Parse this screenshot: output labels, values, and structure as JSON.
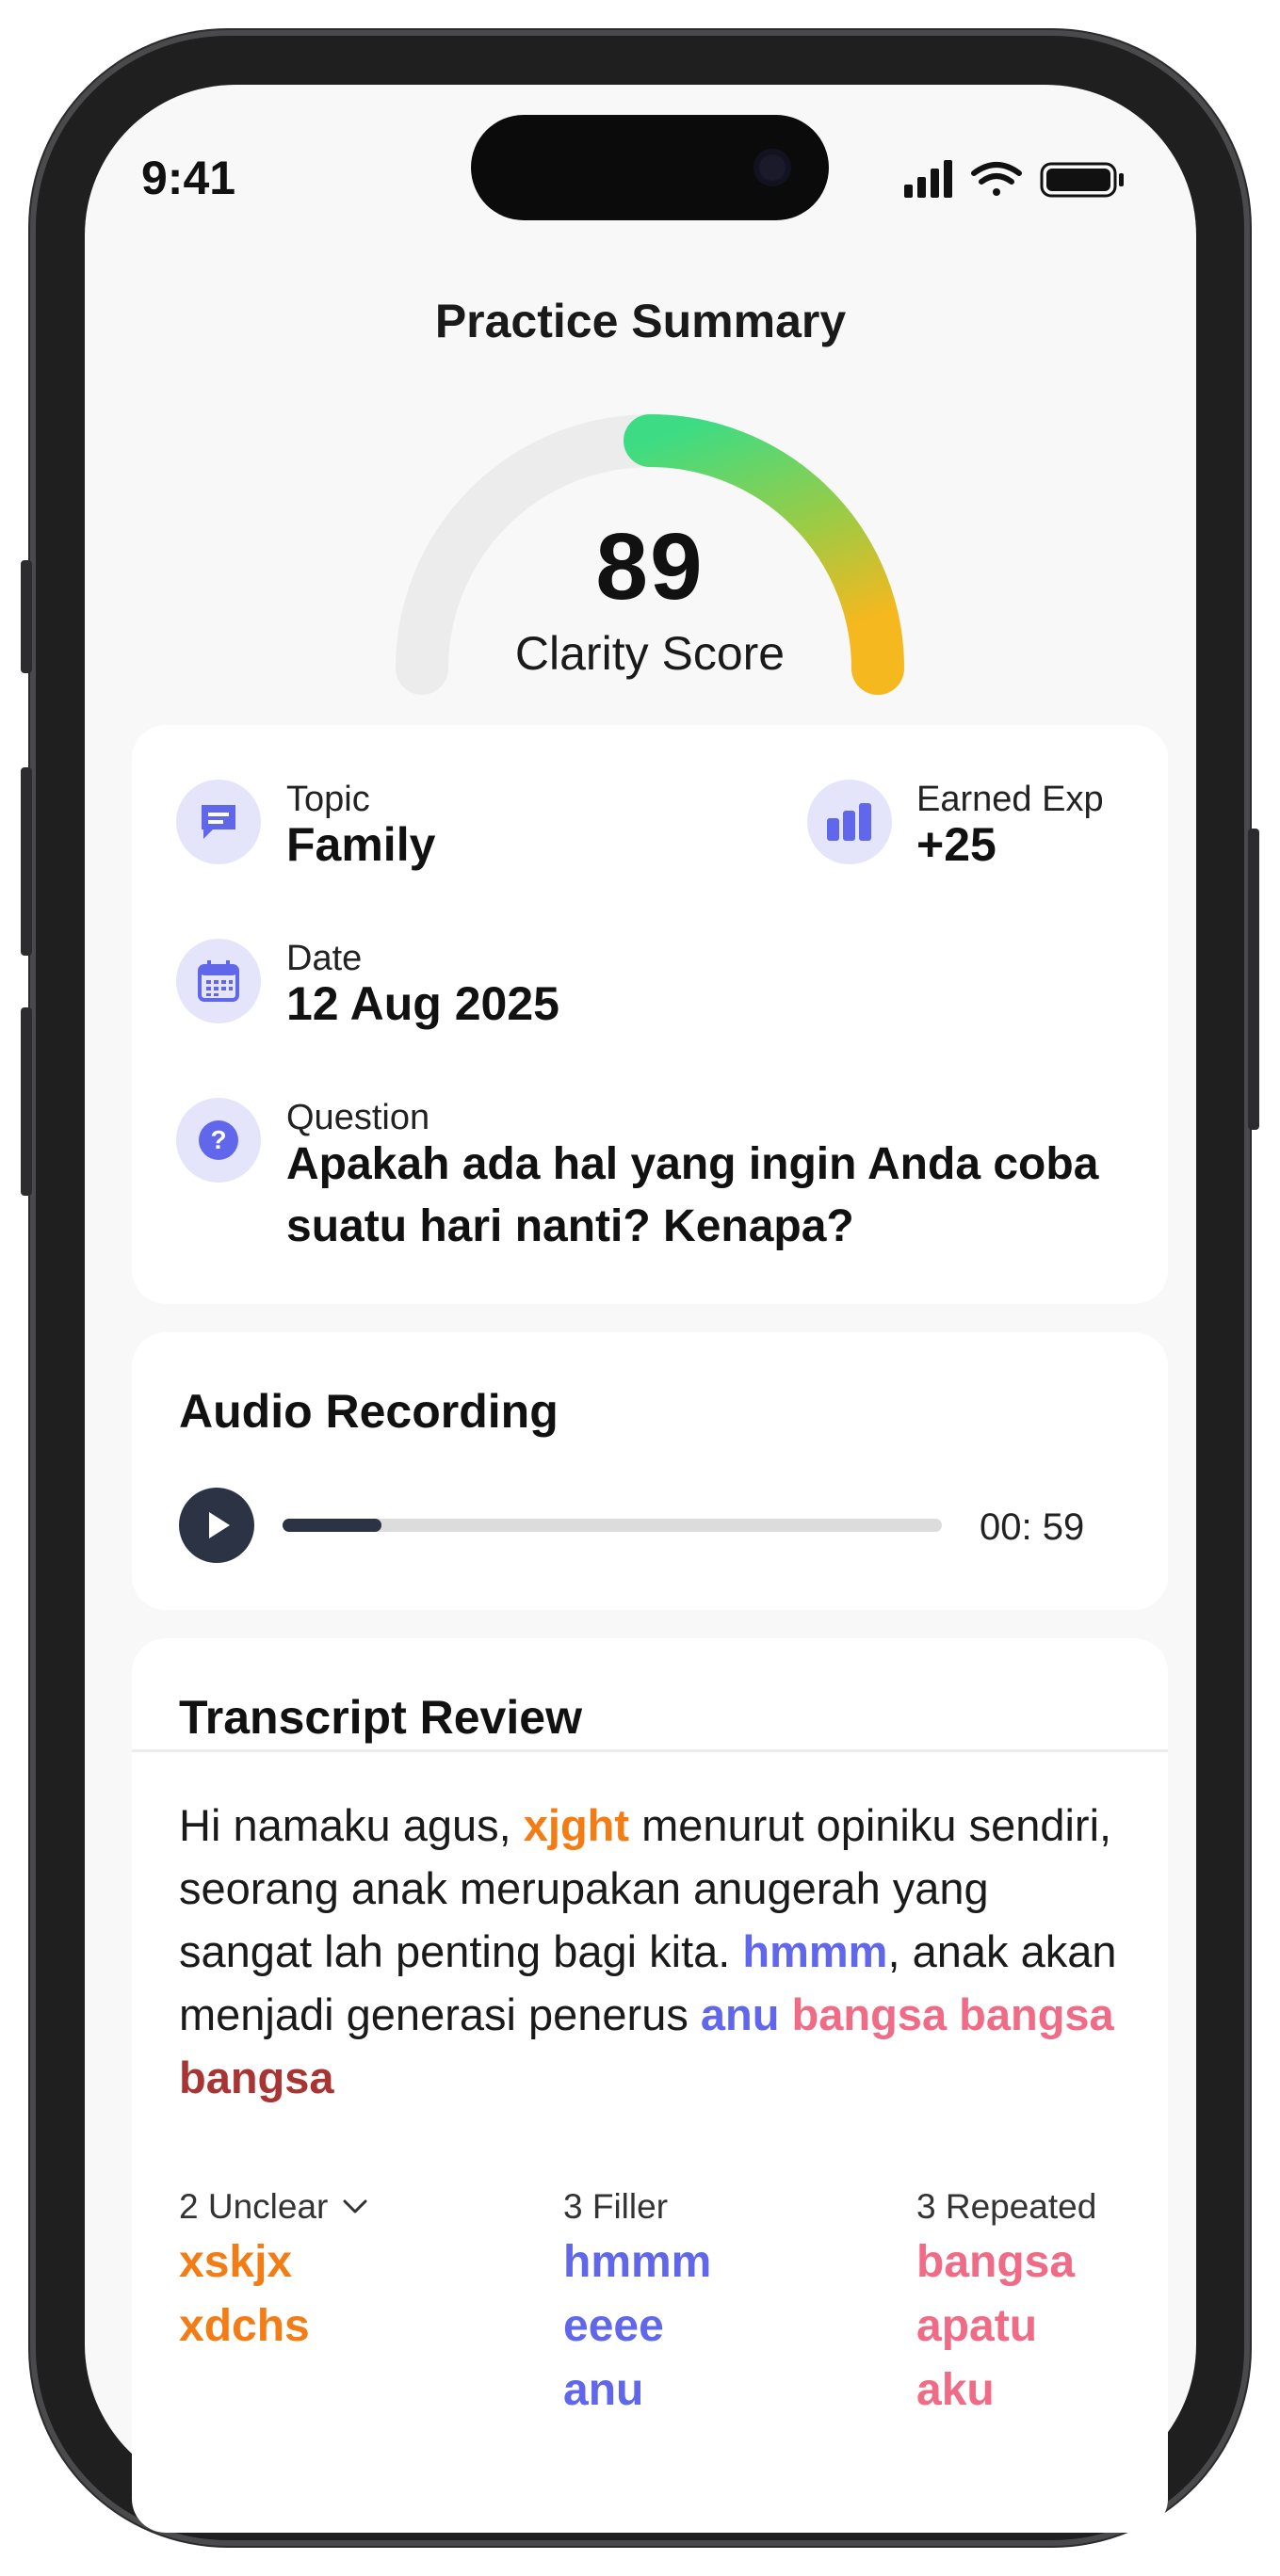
{
  "status": {
    "time": "9:41"
  },
  "header": {
    "title": "Practice Summary"
  },
  "score": {
    "value": "89",
    "label": "Clarity Score",
    "fraction": 0.89
  },
  "details": {
    "topic": {
      "label": "Topic",
      "value": "Family"
    },
    "exp": {
      "label": "Earned Exp",
      "value": "+25"
    },
    "date": {
      "label": "Date",
      "value": "12 Aug 2025"
    },
    "question": {
      "label": "Question",
      "value": "Apakah ada hal yang ingin Anda coba suatu hari nanti? Kenapa?"
    }
  },
  "audio": {
    "title": "Audio Recording",
    "duration": "00: 59",
    "progress": 0.15
  },
  "transcript": {
    "title": "Transcript Review",
    "segments": [
      {
        "text": "Hi namaku agus, ",
        "type": "plain"
      },
      {
        "text": "xjght",
        "type": "unclear"
      },
      {
        "text": " menurut opiniku sendiri, seorang anak merupakan anugerah yang sangat lah penting bagi kita. ",
        "type": "plain"
      },
      {
        "text": "hmmm",
        "type": "filler"
      },
      {
        "text": ", anak akan menjadi generasi penerus ",
        "type": "plain"
      },
      {
        "text": "anu",
        "type": "filler"
      },
      {
        "text": " ",
        "type": "plain"
      },
      {
        "text": "bangsa bangsa",
        "type": "repeated"
      },
      {
        "text": " ",
        "type": "plain"
      },
      {
        "text": "bangsa",
        "type": "repeated-dark"
      }
    ],
    "summary": {
      "unclear": {
        "label": "2 Unclear",
        "items": [
          "xskjx",
          "xdchs"
        ]
      },
      "filler": {
        "label": "3 Filler",
        "items": [
          "hmmm",
          "eeee",
          "anu"
        ]
      },
      "repeated": {
        "label": "3 Repeated",
        "items": [
          "bangsa",
          "apatu",
          "aku"
        ]
      }
    }
  },
  "colors": {
    "accent": "#6067ea",
    "unclear": "#f47c14",
    "filler": "#6067ea",
    "repeated": "#ef6b86",
    "gauge_start": "#3ddc84",
    "gauge_end": "#f5b81f"
  }
}
